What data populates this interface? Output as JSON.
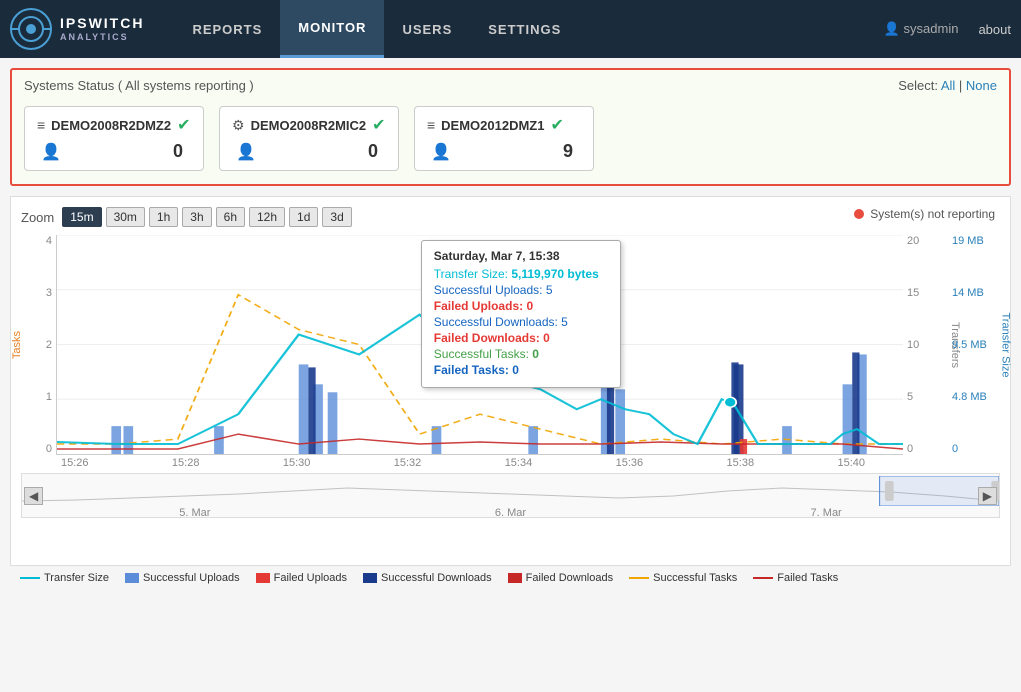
{
  "header": {
    "logo_line1": "IPSWITCH",
    "logo_line2": "ANALYTICS",
    "nav_items": [
      {
        "label": "REPORTS",
        "active": false
      },
      {
        "label": "MONITOR",
        "active": true
      },
      {
        "label": "USERS",
        "active": false
      },
      {
        "label": "SETTINGS",
        "active": false
      }
    ],
    "user": "sysadmin",
    "about": "about"
  },
  "systems_status": {
    "title": "Systems Status ( All systems reporting )",
    "select_label": "Select:",
    "select_all": "All",
    "select_none": "None",
    "systems": [
      {
        "name": "DEMO2008R2DMZ2",
        "type": "server",
        "count": 0
      },
      {
        "name": "DEMO2008R2MIC2",
        "type": "gear",
        "count": 0
      },
      {
        "name": "DEMO2012DMZ1",
        "type": "server",
        "count": 9
      }
    ]
  },
  "chart": {
    "not_reporting_label": "System(s) not reporting",
    "zoom_label": "Zoom",
    "zoom_buttons": [
      "15m",
      "30m",
      "1h",
      "3h",
      "6h",
      "12h",
      "1d",
      "3d"
    ],
    "zoom_active": "15m",
    "y_axis_left": [
      "4",
      "3",
      "2",
      "1",
      "0"
    ],
    "y_axis_left_label": "Tasks",
    "y_axis_right": [
      "20",
      "15",
      "10",
      "5",
      "0"
    ],
    "y_axis_right_label": "Transfers",
    "y_axis_right2": [
      "19 MB",
      "14 MB",
      "9.5 MB",
      "4.8 MB",
      "0"
    ],
    "y_axis_right2_label": "Transfer Size",
    "x_axis": [
      "15:26",
      "15:28",
      "15:30",
      "15:32",
      "15:34",
      "15:36",
      "15:38",
      "15:40"
    ],
    "mini_dates": [
      "5. Mar",
      "6. Mar",
      "7. Mar"
    ],
    "tooltip": {
      "title": "Saturday, Mar 7, 15:38",
      "transfer_size_label": "Transfer Size:",
      "transfer_size_value": "5,119,970 bytes",
      "rows": [
        {
          "label": "Successful Uploads:",
          "value": "5",
          "class": "blue"
        },
        {
          "label": "Failed Uploads:",
          "value": "0",
          "class": "bold-red"
        },
        {
          "label": "Successful Downloads:",
          "value": "5",
          "class": "blue"
        },
        {
          "label": "Failed Downloads:",
          "value": "0",
          "class": "bold-red"
        },
        {
          "label": "Successful Tasks:",
          "value": "0",
          "class": "green"
        },
        {
          "label": "Failed Tasks:",
          "value": "0",
          "class": "bold-blue"
        }
      ]
    }
  },
  "legend": [
    {
      "label": "Transfer Size",
      "color": "#00bcd4",
      "type": "line"
    },
    {
      "label": "Successful Uploads",
      "color": "#5b8dd9",
      "type": "bar"
    },
    {
      "label": "Failed Uploads",
      "color": "#e53935",
      "type": "bar"
    },
    {
      "label": "Successful Downloads",
      "color": "#1a3a8c",
      "type": "bar"
    },
    {
      "label": "Failed Downloads",
      "color": "#c62828",
      "type": "bar"
    },
    {
      "label": "Successful Tasks",
      "color": "#f0a500",
      "type": "dashed"
    },
    {
      "label": "Failed Tasks",
      "color": "#c62828",
      "type": "line"
    }
  ]
}
